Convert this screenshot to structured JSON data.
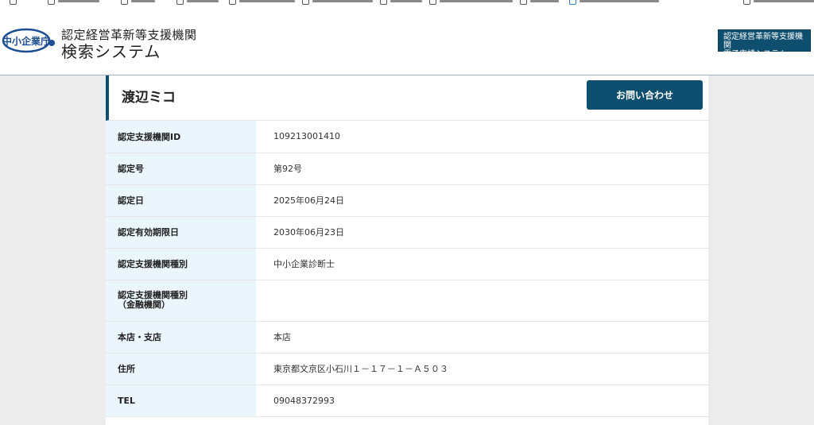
{
  "header": {
    "logo_text": "中小企業庁",
    "title_line1": "認定経営革新等支援機関",
    "title_line2": "検索システム",
    "e_app_line1": "認定経営革新等支援機関",
    "e_app_line2": "電子申請システム"
  },
  "detail": {
    "name": "渡辺ミコ",
    "contact_label": "お問い合わせ",
    "rows": [
      {
        "label": "認定支援機関ID",
        "value": "109213001410"
      },
      {
        "label": "認定号",
        "value": "第92号"
      },
      {
        "label": "認定日",
        "value": "2025年06月24日"
      },
      {
        "label": "認定有効期限日",
        "value": "2030年06月23日"
      },
      {
        "label": "認定支援機関種別",
        "value": "中小企業診断士"
      },
      {
        "label_line1": "認定支援機関種別",
        "label_line2": "（金融機関）",
        "value": ""
      },
      {
        "label": "本店・支店",
        "value": "本店"
      },
      {
        "label": "住所",
        "value": "東京都文京区小石川１－１７－１－Ａ５０３"
      },
      {
        "label": "TEL",
        "value": "09048372993"
      }
    ]
  },
  "colors": {
    "brand": "#0e4e6e",
    "label_bg": "#eaf5fc",
    "page_bg": "#ececec"
  }
}
